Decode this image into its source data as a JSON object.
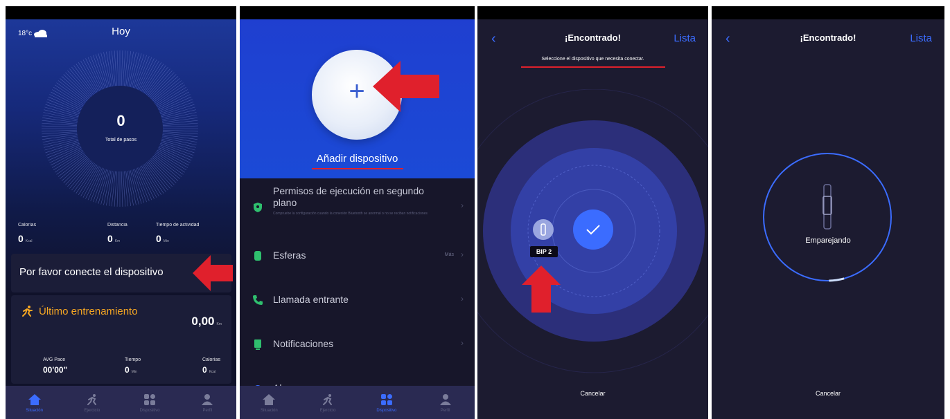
{
  "home": {
    "weather": "18°c",
    "title": "Hoy",
    "steps": "0",
    "steps_label": "Total de pasos",
    "stats": [
      {
        "label": "Calorías",
        "value": "0",
        "unit": "Kcal"
      },
      {
        "label": "Distancia",
        "value": "0",
        "unit": "Km"
      },
      {
        "label": "Tiempo de actividad",
        "value": "0",
        "unit": "Min"
      }
    ],
    "connect_text": "Por favor conecte el dispositivo",
    "training": {
      "title": "Último entrenamiento",
      "value": "0,00",
      "unit": "Km",
      "stats": [
        {
          "label": "AVG Pace",
          "value": "00'00\""
        },
        {
          "label": "Tiempo",
          "value": "0",
          "unit": "Min"
        },
        {
          "label": "Calorías",
          "value": "0",
          "unit": "Kcal"
        }
      ]
    }
  },
  "tabs": [
    {
      "label": "Situación",
      "icon": "home-icon"
    },
    {
      "label": "Ejercicio",
      "icon": "runner-icon"
    },
    {
      "label": "Dispositivo",
      "icon": "device-icon"
    },
    {
      "label": "Perfil",
      "icon": "profile-icon"
    }
  ],
  "devices": {
    "add_label": "Añadir dispositivo",
    "menu": [
      {
        "title": "Permisos de ejecución en segundo plano",
        "sub": "Compruebe la configuración cuando la conexión Bluetooth se anormal o no se reciban notificaciones",
        "icon": "shield-icon",
        "color": "#2fbf6e"
      },
      {
        "title": "Esferas",
        "extra": "Más",
        "icon": "watchface-icon",
        "color": "#2fbf6e"
      },
      {
        "title": "Llamada entrante",
        "icon": "phone-icon",
        "color": "#2fbf6e"
      },
      {
        "title": "Notificaciones",
        "icon": "notification-icon",
        "color": "#2fbf6e"
      },
      {
        "title": "Alarma",
        "icon": "alarm-icon",
        "color": "#3b6cff"
      }
    ]
  },
  "found": {
    "title": "¡Encontrado!",
    "list_label": "Lista",
    "subtitle": "Seleccione el dispositivo que necesita conectar.",
    "device_name": "BIP 2",
    "cancel": "Cancelar"
  },
  "pairing": {
    "title": "¡Encontrado!",
    "list_label": "Lista",
    "status": "Emparejando",
    "cancel": "Cancelar"
  },
  "colors": {
    "accent": "#3b6cff",
    "annotation_red": "#e0202c",
    "training_orange": "#f5a623"
  }
}
